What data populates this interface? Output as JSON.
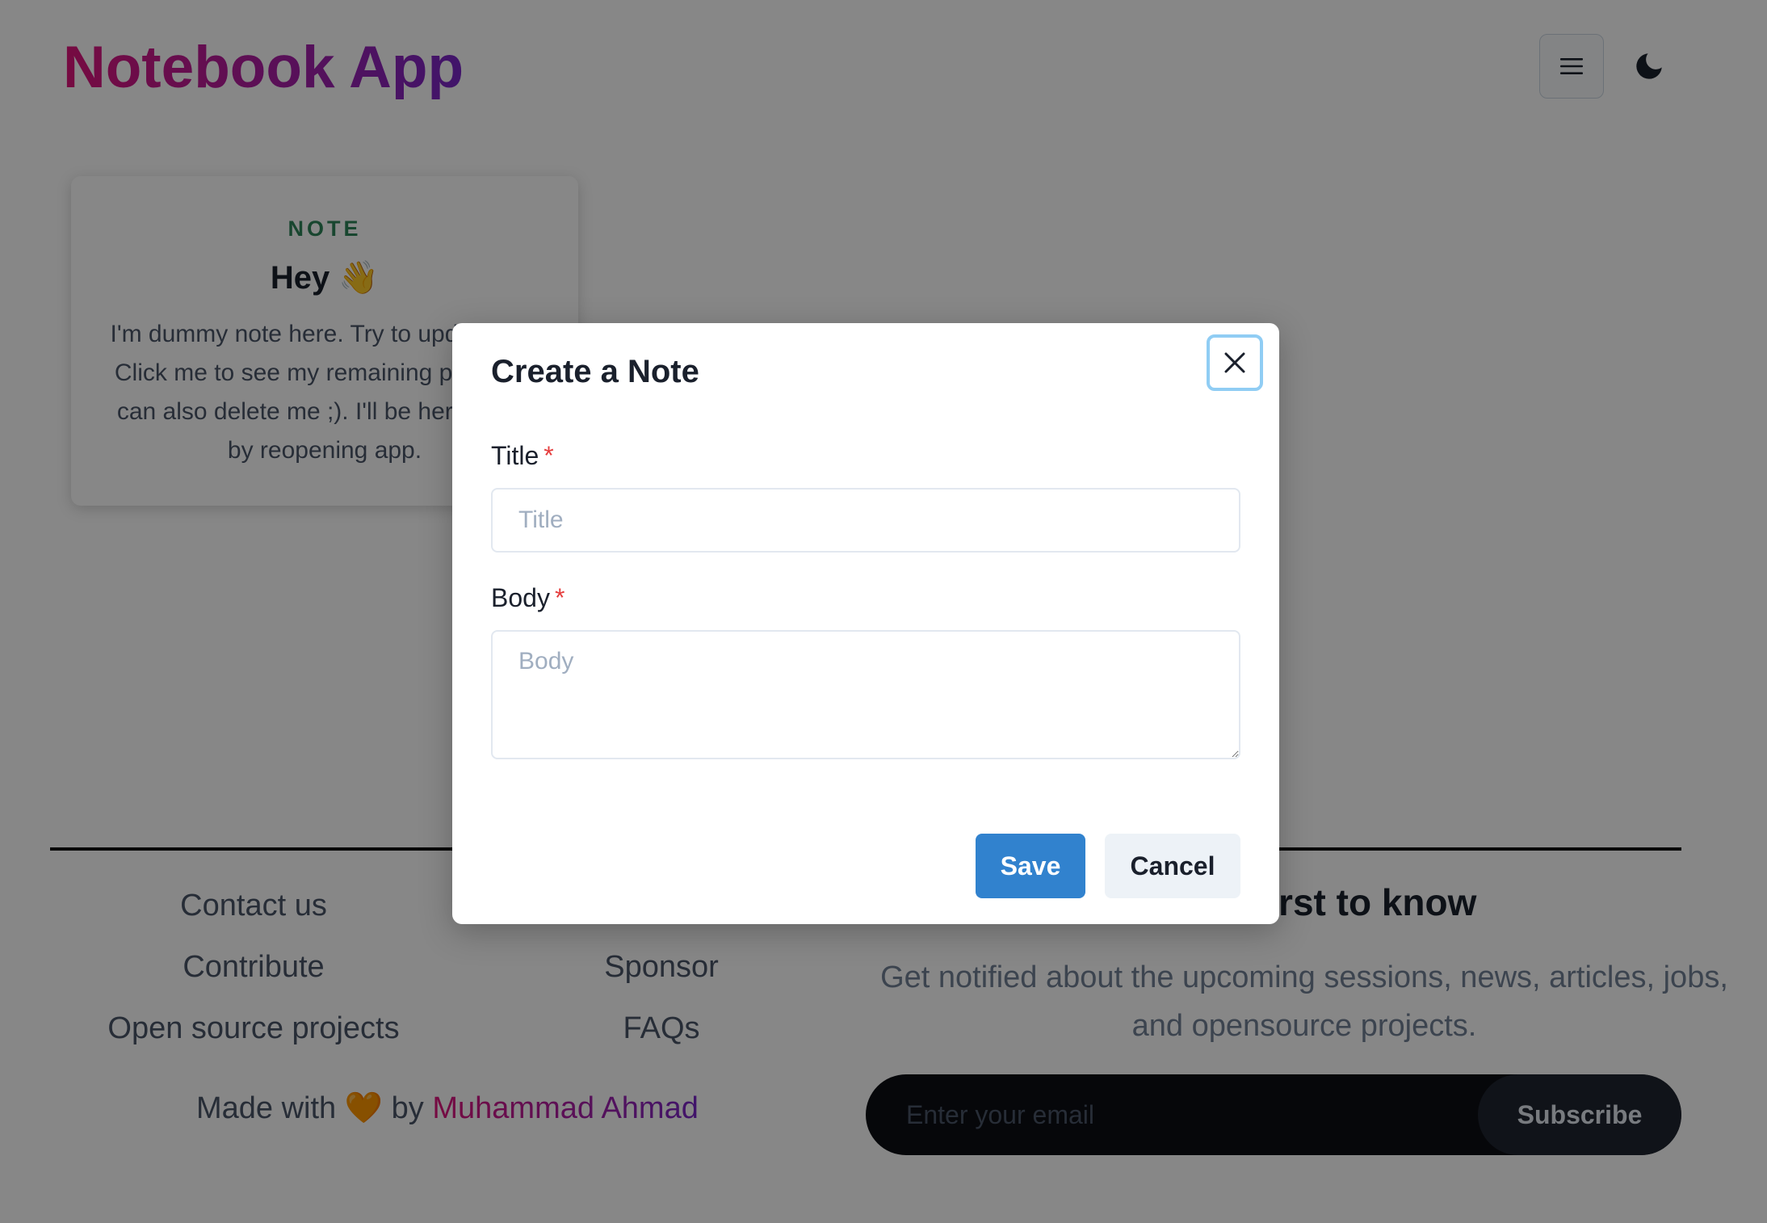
{
  "header": {
    "app_title": "Notebook App"
  },
  "note_card": {
    "tag": "NOTE",
    "title": "Hey 👋",
    "body": "I'm dummy note here. Try to update me. Click me to see my remaining part. You can also delete me ;). I'll be here again by reopening app."
  },
  "footer": {
    "links_left": [
      "Contact us",
      "Contribute",
      "Open source projects"
    ],
    "links_middle": [
      "",
      "Sponsor",
      "FAQs"
    ],
    "made_with_prefix": "Made with",
    "heart": "🧡",
    "made_with_by": "by",
    "author": "Muhammad Ahmad",
    "newsletter_heading": "Be the first to know",
    "newsletter_desc": "Get notified about the upcoming sessions, news, articles, jobs, and opensource projects.",
    "email_placeholder": "Enter your email",
    "subscribe_label": "Subscribe"
  },
  "modal": {
    "title": "Create a Note",
    "title_field": {
      "label": "Title",
      "required_mark": "*",
      "placeholder": "Title",
      "value": ""
    },
    "body_field": {
      "label": "Body",
      "required_mark": "*",
      "placeholder": "Body",
      "value": ""
    },
    "save_label": "Save",
    "cancel_label": "Cancel"
  },
  "icons": {
    "menu": "hamburger-menu-icon",
    "theme": "moon-icon",
    "close": "close-icon"
  },
  "colors": {
    "brand_gradient_start": "#e0157c",
    "brand_gradient_end": "#7a27c9",
    "note_tag": "#2f855a",
    "primary_button": "#3182ce",
    "required_mark": "#e53e3e",
    "close_focus_ring": "#90cdf4",
    "subscribe_bg": "#0d0f14"
  }
}
